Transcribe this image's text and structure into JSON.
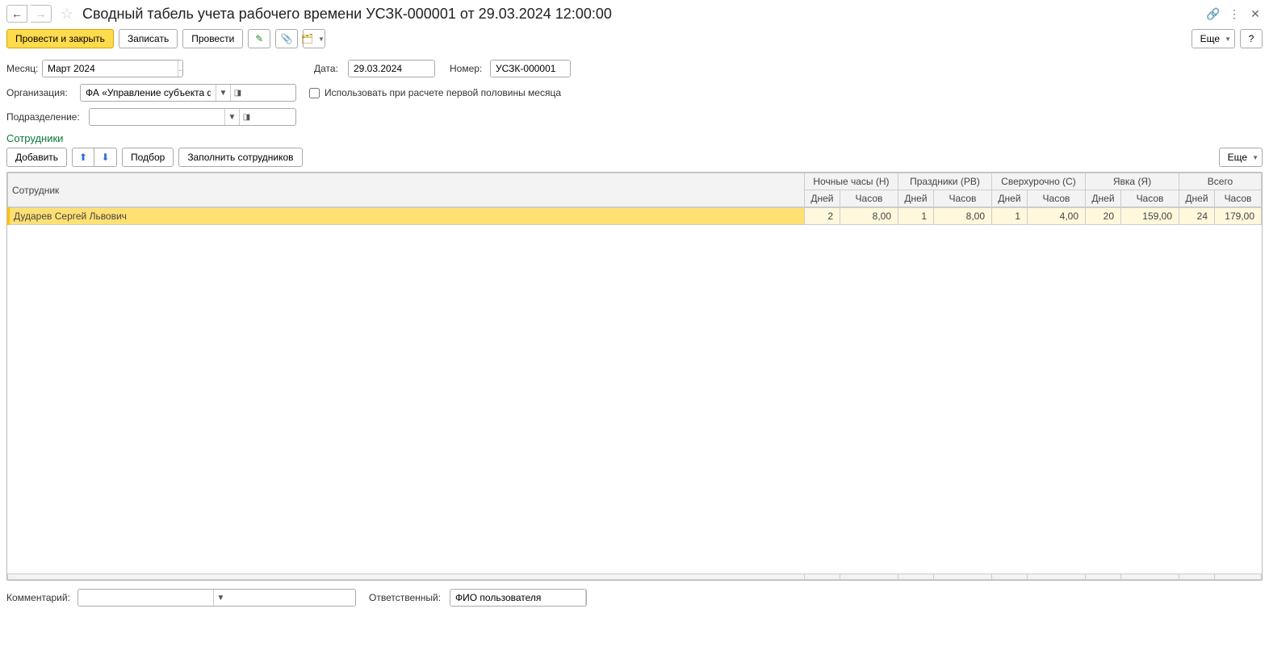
{
  "title": "Сводный табель учета рабочего времени УСЗК-000001 от 29.03.2024 12:00:00",
  "toolbar": {
    "post_close": "Провести и закрыть",
    "save": "Записать",
    "post": "Провести",
    "more": "Еще"
  },
  "form": {
    "month_label": "Месяц:",
    "month_value": "Март 2024",
    "date_label": "Дата:",
    "date_value": "29.03.2024",
    "number_label": "Номер:",
    "number_value": "УСЗК-000001",
    "org_label": "Организация:",
    "org_value": "ФА «Управление субъекта федерации»",
    "dept_label": "Подразделение:",
    "dept_value": "",
    "use_first_half": "Использовать при расчете первой половины месяца"
  },
  "section": {
    "title": "Сотрудники",
    "add": "Добавить",
    "select": "Подбор",
    "fill": "Заполнить сотрудников",
    "more": "Еще"
  },
  "table": {
    "headers": {
      "employee": "Сотрудник",
      "night": "Ночные часы (Н)",
      "holiday": "Праздники (РВ)",
      "overtime": "Сверхурочно (С)",
      "attendance": "Явка (Я)",
      "total": "Всего",
      "days": "Дней",
      "hours": "Часов"
    },
    "rows": [
      {
        "name": "Дударев Сергей Львович",
        "night_days": "2",
        "night_hours": "8,00",
        "holiday_days": "1",
        "holiday_hours": "8,00",
        "overtime_days": "1",
        "overtime_hours": "4,00",
        "attendance_days": "20",
        "attendance_hours": "159,00",
        "total_days": "24",
        "total_hours": "179,00"
      }
    ]
  },
  "footer": {
    "comment_label": "Комментарий:",
    "comment_value": "",
    "responsible_label": "Ответственный:",
    "responsible_value": "ФИО пользователя"
  },
  "help": "?"
}
